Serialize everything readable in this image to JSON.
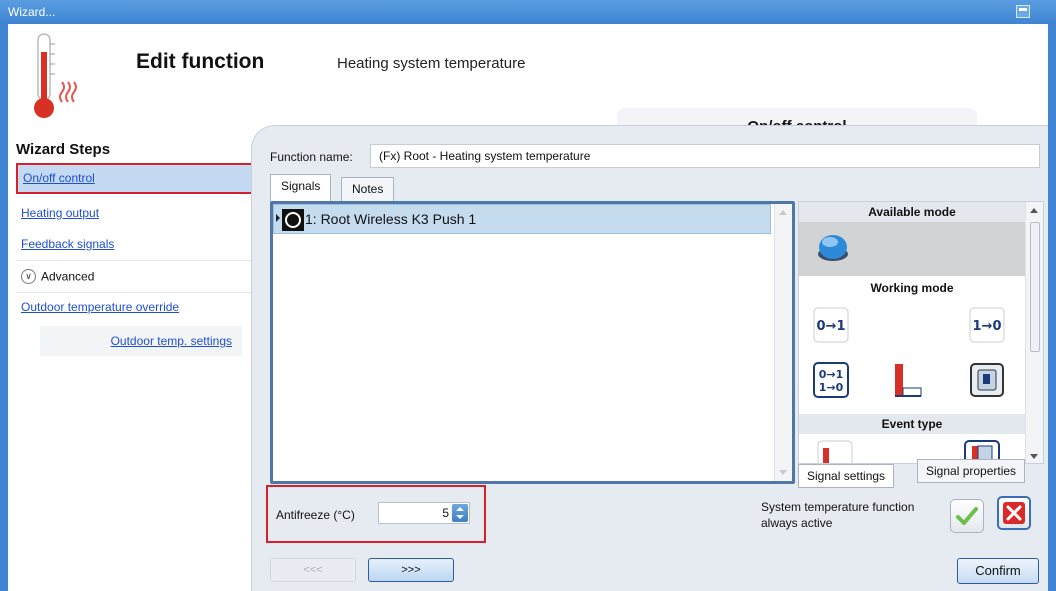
{
  "window": {
    "title": "Wizard..."
  },
  "header": {
    "title": "Edit function",
    "subtitle": "Heating system temperature",
    "step_tab": "On/off control"
  },
  "wizard_steps": {
    "title": "Wizard Steps",
    "items": [
      {
        "label": "On/off control",
        "selected": true
      },
      {
        "label": "Heating output"
      },
      {
        "label": "Feedback signals"
      }
    ],
    "advanced": {
      "label": "Advanced",
      "items": [
        {
          "label": "Outdoor temperature override"
        },
        {
          "label": "Outdoor temp. settings"
        }
      ]
    }
  },
  "main": {
    "function_name_label": "Function name:",
    "function_name_value": "(Fx) Root - Heating system temperature",
    "tabs": [
      {
        "label": "Signals"
      },
      {
        "label": "Notes"
      }
    ],
    "signals": [
      {
        "label": "1: Root Wireless K3 Push 1"
      }
    ],
    "mode_panel": {
      "available_mode": "Available mode",
      "working_mode": "Working mode",
      "event_type": "Event type"
    },
    "signal_tabs": [
      {
        "label": "Signal settings"
      },
      {
        "label": "Signal properties"
      }
    ],
    "antifreeze": {
      "label": "Antifreeze (°C)",
      "value": "5"
    },
    "system_temp": {
      "label": "System temperature function always active"
    },
    "nav": {
      "prev": "<<<",
      "next": ">>>",
      "confirm": "Confirm"
    }
  },
  "colors": {
    "accent": "#3f85d3",
    "selection": "#c5dbee",
    "highlight_border": "#d8202a",
    "link": "#1f4fd1"
  }
}
